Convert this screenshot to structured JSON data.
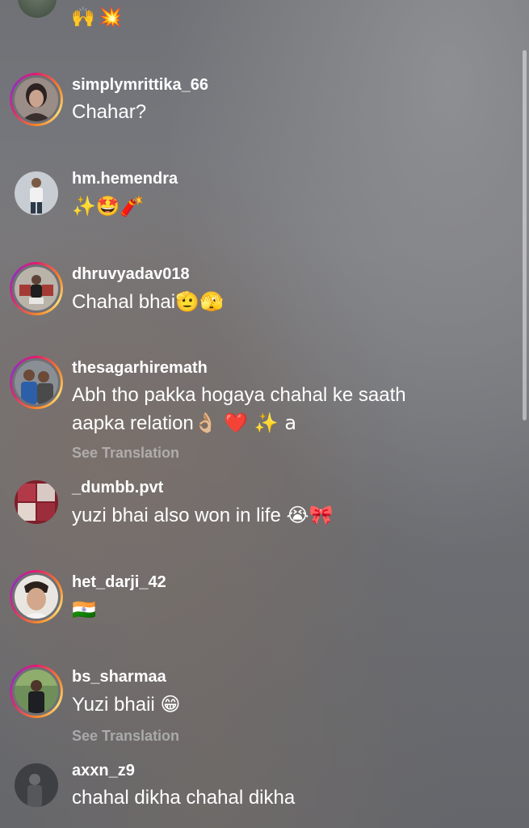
{
  "top": {
    "partial_emoji": "🙌💥"
  },
  "comments": [
    {
      "username": "simplymrittika_66",
      "text": "Chahar?",
      "emoji": "",
      "avatar": "photo-woman",
      "ring": true
    },
    {
      "username": "hm.hemendra",
      "text": "",
      "emoji": "✨🤩🧨",
      "avatar": "photo-man-standing",
      "ring": false
    },
    {
      "username": "dhruvyadav018",
      "text": "Chahal bhai",
      "emoji": "🫡🫣",
      "avatar": "photo-man-sitting",
      "ring": true
    },
    {
      "username": "thesagarhiremath",
      "text": "Abh tho pakka hogaya chahal ke saath aapka relation",
      "emoji": "👌🏼 ❤️ ✨ a",
      "avatar": "photo-group",
      "ring": true,
      "see_translation": "See Translation"
    },
    {
      "username": "_dumbb.pvt",
      "text": "yuzi bhai also won in life",
      "emoji": "😭🎀",
      "avatar": "photo-red-collage",
      "ring": false
    },
    {
      "username": "het_darji_42",
      "text": "",
      "emoji": "🇮🇳",
      "avatar": "photo-selfie",
      "ring": true
    },
    {
      "username": "bs_sharmaa",
      "text": "Yuzi bhaii",
      "emoji": "😁",
      "avatar": "photo-man-trees",
      "ring": true,
      "see_translation": "See Translation"
    },
    {
      "username": "axxn_z9",
      "text": "chahal dikha chahal dikha",
      "emoji": "",
      "avatar": "photo-dark",
      "ring": false
    }
  ]
}
